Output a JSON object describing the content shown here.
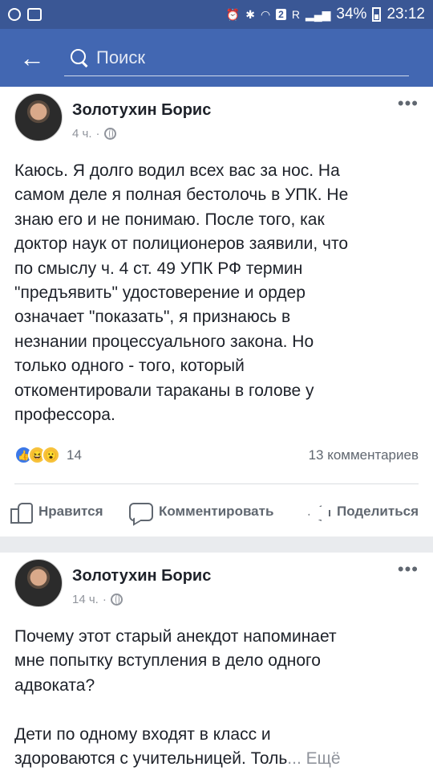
{
  "status_bar": {
    "badge": "2",
    "network": "R",
    "battery": "34%",
    "time": "23:12"
  },
  "app_bar": {
    "back_icon": "arrow-left",
    "search_placeholder": "Поиск"
  },
  "posts": [
    {
      "author": "Золотухин Борис",
      "time": "4 ч.",
      "dot": "·",
      "more_icon": "•••",
      "text": "Каюсь. Я долго водил всех вас за нос. На\nсамом деле я полная бестолочь в УПК. Не\nзнаю его и не понимаю. После того, как\nдоктор наук от полиционеров заявили, что\nпо смыслу ч. 4 ст. 49 УПК РФ термин\n\"предъявить\" удостоверение и ордер\nозначает \"показать\", я признаюсь в\nнезнании процессуального закона. Но\nтолько одного - того, который\nоткоментировали тараканы в голове у\nпрофессора.",
      "reactions_count": "14",
      "comments_count": "13 комментариев",
      "actions": {
        "like": "Нравится",
        "comment": "Комментировать",
        "share": "Поделиться"
      }
    },
    {
      "author": "Золотухин Борис",
      "time": "14 ч.",
      "dot": "·",
      "more_icon": "•••",
      "text": "Почему этот старый анекдот напоминает\nмне попытку вступления в дело одного\nадвоката?\n\nДети по одному входят в класс и\nздороваются с учительницей. Толь",
      "more_link": "... Ещё"
    }
  ]
}
